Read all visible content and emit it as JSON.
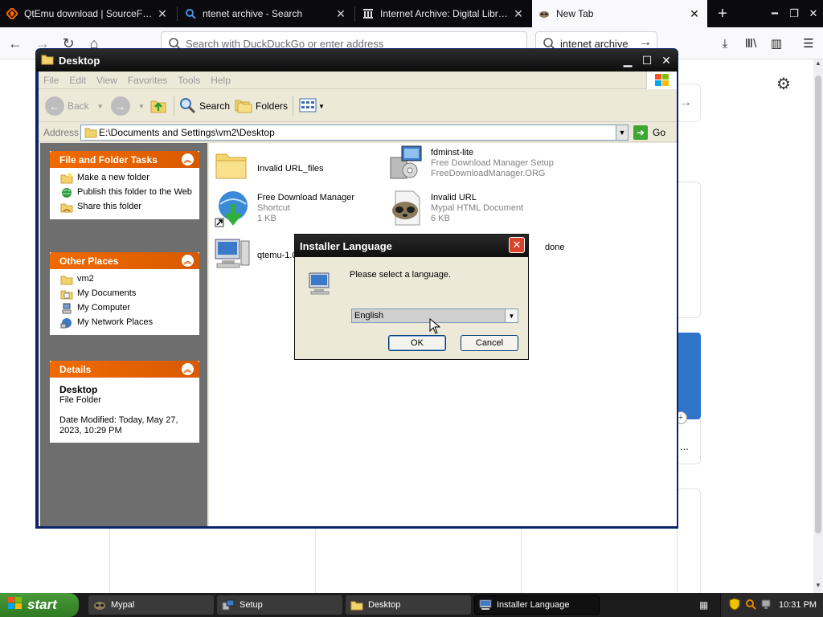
{
  "browser": {
    "tabs": [
      {
        "label": "QtEmu download | SourceForge.net",
        "icon": "sourceforge-icon",
        "active": false
      },
      {
        "label": "ntenet archive - Search",
        "icon": "search-icon",
        "active": false
      },
      {
        "label": "Internet Archive: Digital Library of Free",
        "icon": "archive-icon",
        "active": false
      },
      {
        "label": "New Tab",
        "icon": "raccoon-icon",
        "active": true
      }
    ],
    "url_placeholder": "Search with DuckDuckGo or enter address",
    "search_value": "intenet archive"
  },
  "explorer": {
    "title": "Desktop",
    "menu": [
      "File",
      "Edit",
      "View",
      "Favorites",
      "Tools",
      "Help"
    ],
    "toolbar": {
      "back": "Back",
      "search": "Search",
      "folders": "Folders"
    },
    "address_label": "Address",
    "address_value": "E:\\Documents and Settings\\vm2\\Desktop",
    "go_label": "Go",
    "panels": {
      "tasks": {
        "title": "File and Folder Tasks",
        "items": [
          "Make a new folder",
          "Publish this folder to the Web",
          "Share this folder"
        ]
      },
      "places": {
        "title": "Other Places",
        "items": [
          "vm2",
          "My Documents",
          "My Computer",
          "My Network Places"
        ]
      },
      "details": {
        "title": "Details",
        "name": "Desktop",
        "type": "File Folder",
        "modified": "Date Modified: Today, May 27, 2023, 10:29 PM"
      }
    },
    "files": [
      {
        "name": "Invalid URL_files",
        "line2": "",
        "line3": ""
      },
      {
        "name": "fdminst-lite",
        "line2": "Free Download Manager Setup",
        "line3": "FreeDownloadManager.ORG"
      },
      {
        "name": "Free Download Manager",
        "line2": "Shortcut",
        "line3": "1 KB"
      },
      {
        "name": "Invalid URL",
        "line2": "Mypal HTML Document",
        "line3": "6 KB"
      },
      {
        "name": "qtemu-1.0",
        "line2": "",
        "line3": ""
      },
      {
        "name": "done",
        "line2": "",
        "line3": ""
      }
    ]
  },
  "dialog": {
    "title": "Installer Language",
    "message": "Please select a language.",
    "selected_language": "English",
    "ok_label": "OK",
    "cancel_label": "Cancel"
  },
  "taskbar": {
    "start_label": "start",
    "items": [
      "Mypal",
      "Setup",
      "Desktop",
      "Installer Language"
    ],
    "clock": "10:31 PM"
  },
  "page": {
    "ellipsis": "..."
  }
}
